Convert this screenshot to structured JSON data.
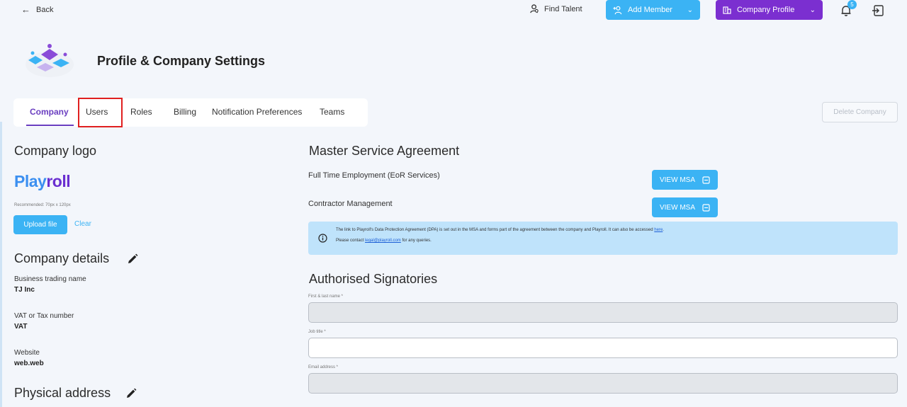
{
  "topbar": {
    "back_label": "Back",
    "find_talent_label": "Find Talent",
    "add_member_label": "Add Member",
    "company_profile_label": "Company Profile",
    "notifications_count": "5"
  },
  "header": {
    "title": "Profile & Company Settings"
  },
  "tabs": [
    {
      "label": "Company",
      "active": true
    },
    {
      "label": "Users",
      "active": false
    },
    {
      "label": "Roles",
      "active": false
    },
    {
      "label": "Billing",
      "active": false
    },
    {
      "label": "Notification Preferences",
      "active": false
    },
    {
      "label": "Teams",
      "active": false
    }
  ],
  "delete_company_label": "Delete Company",
  "company_logo": {
    "heading": "Company logo",
    "brand_part1": "Play",
    "brand_part2": "roll",
    "recommended": "Recommended: 70px x 120px",
    "upload_label": "Upload file",
    "clear_label": "Clear"
  },
  "company_details": {
    "heading": "Company details",
    "fields": [
      {
        "label": "Business trading name",
        "value": "TJ Inc"
      },
      {
        "label": "VAT or Tax number",
        "value": "VAT"
      },
      {
        "label": "Website",
        "value": "web.web"
      }
    ]
  },
  "physical_address": {
    "heading": "Physical address"
  },
  "msa": {
    "heading": "Master Service Agreement",
    "rows": [
      {
        "label": "Full Time Employment (EoR Services)",
        "button": "VIEW MSA"
      },
      {
        "label": "Contractor Management",
        "button": "VIEW MSA"
      }
    ],
    "info_line1": "The link to Playroll's Data Protection Agreement (DPA) is set out in the MSA and forms part of the agreement between the company and Playroll. It can also be accessed",
    "info_link1": "here",
    "info_line2_pre": "Please contact",
    "info_email": "legal@playroll.com",
    "info_line2_post": "for any queries."
  },
  "signatories": {
    "heading": "Authorised Signatories",
    "fields": [
      {
        "label": "First & last name *",
        "value": "",
        "disabled": true
      },
      {
        "label": "Job title *",
        "value": "",
        "disabled": false
      },
      {
        "label": "Email address *",
        "value": "",
        "disabled": true
      }
    ]
  },
  "colors": {
    "accent_blue": "#3bb3f4",
    "accent_purple": "#7b2fd0",
    "tab_active": "#6a3ec0",
    "highlight": "#e02020"
  }
}
